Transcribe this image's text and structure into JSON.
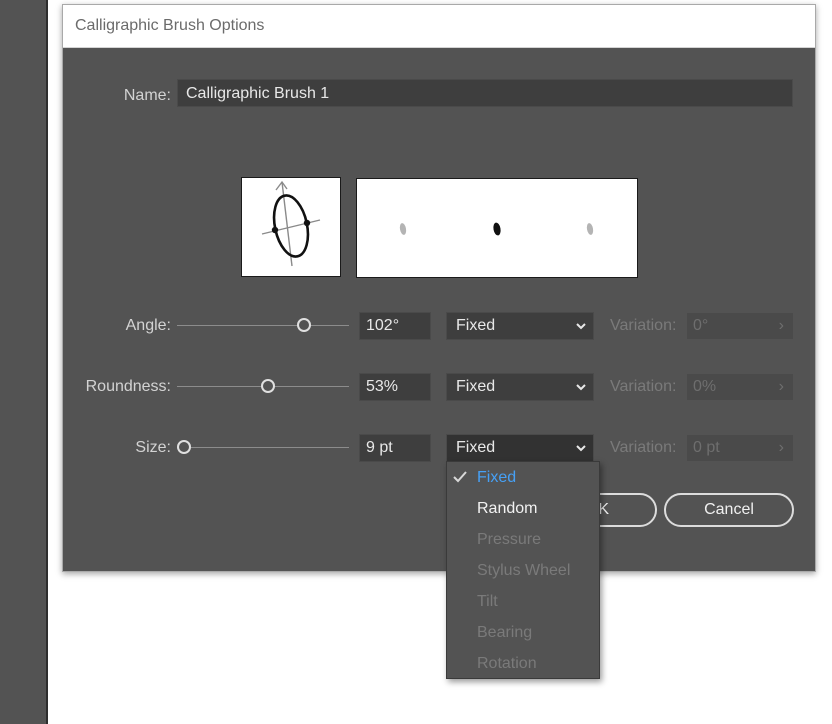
{
  "dialog": {
    "title": "Calligraphic Brush Options"
  },
  "name_field": {
    "label": "Name:",
    "value": "Calligraphic Brush 1"
  },
  "angle": {
    "label": "Angle:",
    "value": "102°",
    "slider_fraction": 0.76,
    "mode": "Fixed",
    "variation_label": "Variation:",
    "variation_value": "0°"
  },
  "roundness": {
    "label": "Roundness:",
    "value": "53%",
    "slider_fraction": 0.53,
    "mode": "Fixed",
    "variation_label": "Variation:",
    "variation_value": "0%"
  },
  "size": {
    "label": "Size:",
    "value": "9 pt",
    "slider_fraction": 0.0,
    "mode": "Fixed",
    "variation_label": "Variation:",
    "variation_value": "0 pt"
  },
  "buttons": {
    "ok_partial": "K",
    "cancel": "Cancel"
  },
  "dropdown": {
    "selected": "Fixed",
    "options": [
      {
        "label": "Fixed",
        "state": "selected"
      },
      {
        "label": "Random",
        "state": "enabled"
      },
      {
        "label": "Pressure",
        "state": "disabled"
      },
      {
        "label": "Stylus Wheel",
        "state": "disabled"
      },
      {
        "label": "Tilt",
        "state": "disabled"
      },
      {
        "label": "Bearing",
        "state": "disabled"
      },
      {
        "label": "Rotation",
        "state": "disabled"
      }
    ]
  },
  "colors": {
    "dialog_bg": "#535353",
    "field_bg": "#3e3e3e",
    "selected_text": "#46a0f5",
    "disabled_text": "#7a7a7a"
  }
}
